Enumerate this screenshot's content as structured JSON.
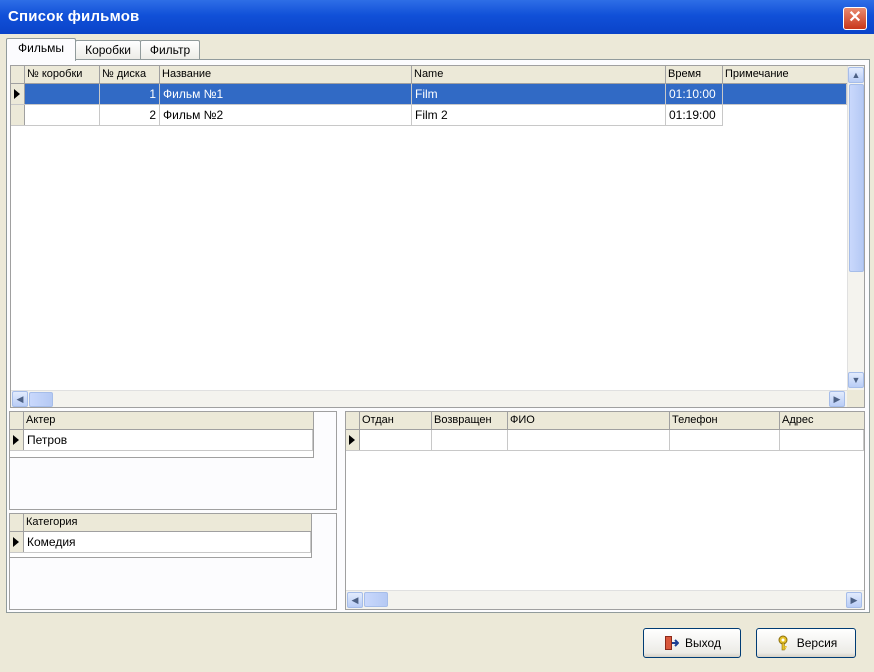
{
  "window": {
    "title": "Список фильмов",
    "close_glyph": "✕"
  },
  "tabs": [
    "Фильмы",
    "Коробки",
    "Фильтр"
  ],
  "films_grid": {
    "columns": [
      "№ коробки",
      "№ диска",
      "Название",
      "Name",
      "Время",
      "Примечание"
    ],
    "rows": [
      {
        "box": "",
        "disc": "1",
        "title": "Фильм №1",
        "name": "Film",
        "time": "01:10:00",
        "note": ""
      },
      {
        "box": "",
        "disc": "2",
        "title": "Фильм №2",
        "name": "Film 2",
        "time": "01:19:00",
        "note": ""
      }
    ]
  },
  "actors_grid": {
    "columns": [
      "Актер"
    ],
    "rows": [
      {
        "actor": "Петров"
      }
    ]
  },
  "category_grid": {
    "columns": [
      "Категория"
    ],
    "rows": [
      {
        "category": "Комедия"
      }
    ]
  },
  "loans_grid": {
    "columns": [
      "Отдан",
      "Возвращен",
      "ФИО",
      "Телефон",
      "Адрес"
    ]
  },
  "buttons": {
    "exit_label": "Выход",
    "version_label": "Версия"
  },
  "icons": {
    "exit": "exit-door-icon",
    "version": "key-icon",
    "close": "close-icon"
  },
  "colors": {
    "title_bar": "#0a43c9",
    "selection": "#316ac5",
    "close_button": "#c9371b"
  }
}
